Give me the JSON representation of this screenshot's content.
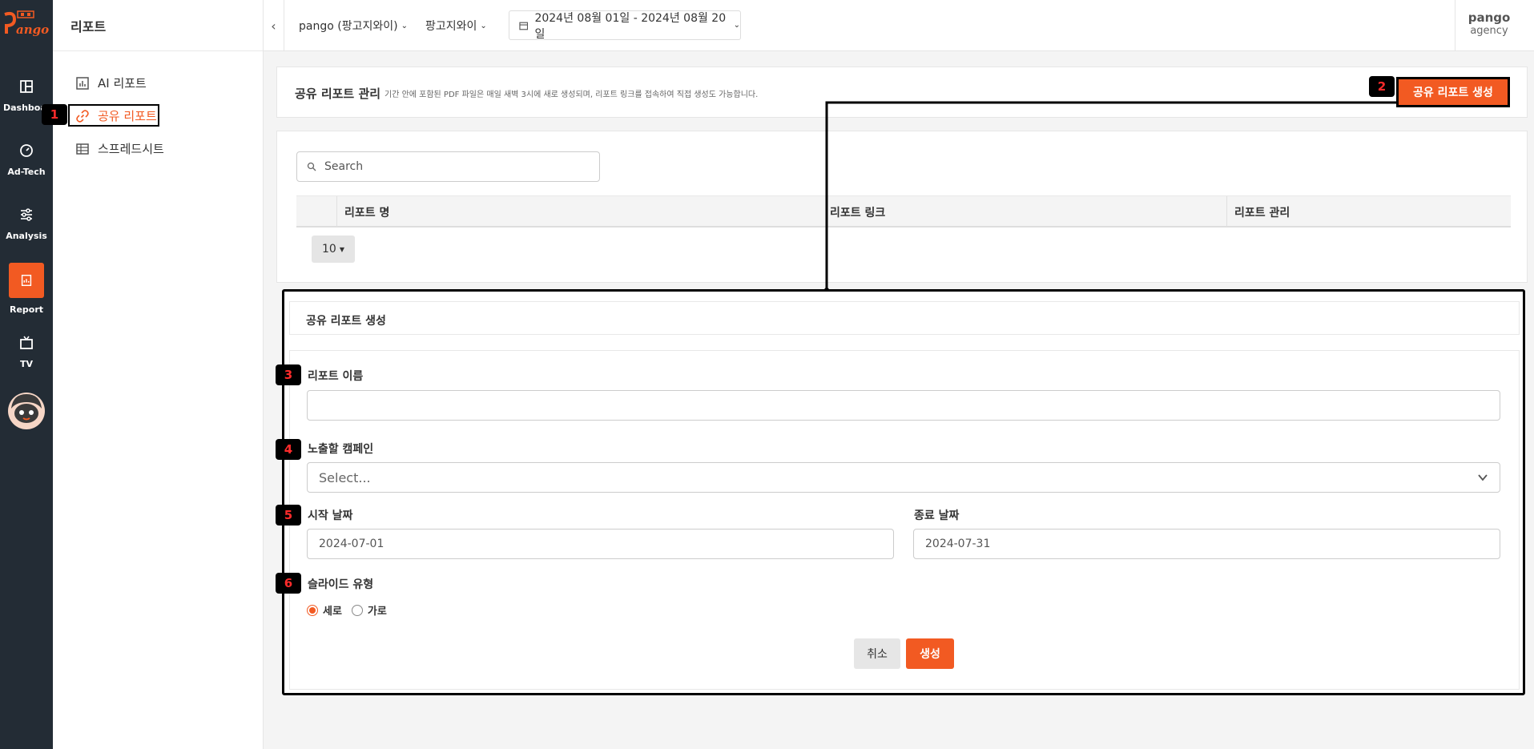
{
  "rail": {
    "logo_text": "Pango",
    "items": [
      {
        "label": "Dashboard",
        "icon": "dashboard-icon"
      },
      {
        "label": "Ad-Tech",
        "icon": "gauge-icon"
      },
      {
        "label": "Analysis",
        "icon": "sliders-icon"
      },
      {
        "label": "Report",
        "icon": "report-icon"
      },
      {
        "label": "TV",
        "icon": "tv-icon"
      }
    ]
  },
  "sidebar": {
    "title": "리포트",
    "items": [
      {
        "label": "AI 리포트",
        "icon": "bar-chart-icon"
      },
      {
        "label": "공유 리포트",
        "icon": "link-icon"
      },
      {
        "label": "스프레드시트",
        "icon": "table-icon"
      }
    ]
  },
  "header": {
    "account": "pango (팡고지와이)",
    "advertiser": "팡고지와이",
    "date_range": "2024년 08월 01일 - 2024년 08월 20일",
    "user_name": "pango",
    "user_role": "agency"
  },
  "management": {
    "title": "공유 리포트 관리",
    "description": "기간 안에 포함된 PDF 파일은 매일 새벽 3시에 새로 생성되며, 리포트 링크를 접속하여 직접 생성도 가능합니다.",
    "create_button": "공유 리포트 생성"
  },
  "table": {
    "search_placeholder": "Search",
    "columns": [
      "리포트 명",
      "리포트 링크",
      "리포트 관리"
    ],
    "page_size": "10"
  },
  "form": {
    "title": "공유 리포트 생성",
    "name_label": "리포트 이름",
    "name_value": "",
    "campaign_label": "노출할 캠페인",
    "campaign_placeholder": "Select...",
    "start_label": "시작 날짜",
    "start_value": "2024-07-01",
    "end_label": "종료 날짜",
    "end_value": "2024-07-31",
    "slide_label": "슬라이드 유형",
    "slide_options": [
      "세로",
      "가로"
    ],
    "slide_selected": "세로",
    "cancel": "취소",
    "submit": "생성"
  },
  "annotations": [
    "1",
    "2",
    "3",
    "4",
    "5",
    "6"
  ],
  "colors": {
    "accent": "#f25a22",
    "rail": "#232c35",
    "annotation": "#ff2b2b"
  }
}
